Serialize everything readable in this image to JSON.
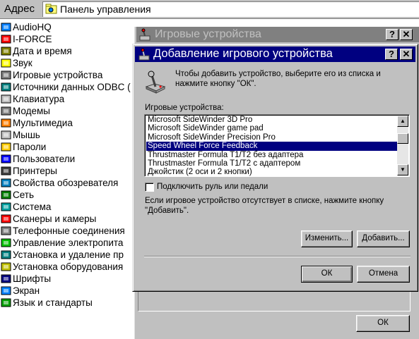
{
  "address_bar": {
    "label": "Адрес",
    "value": "Панель управления"
  },
  "control_panel": {
    "items": [
      {
        "label": "AudioHQ",
        "icon": "audio-icon"
      },
      {
        "label": "I-FORCE",
        "icon": "iforce-icon"
      },
      {
        "label": "Дата и время",
        "icon": "datetime-icon"
      },
      {
        "label": "Звук",
        "icon": "sound-icon"
      },
      {
        "label": "Игровые устройства",
        "icon": "joystick-icon"
      },
      {
        "label": "Источники данных ODBC (",
        "icon": "odbc-icon"
      },
      {
        "label": "Клавиатура",
        "icon": "keyboard-icon"
      },
      {
        "label": "Модемы",
        "icon": "modem-icon"
      },
      {
        "label": "Мультимедиа",
        "icon": "multimedia-icon"
      },
      {
        "label": "Мышь",
        "icon": "mouse-icon"
      },
      {
        "label": "Пароли",
        "icon": "passwords-icon"
      },
      {
        "label": "Пользователи",
        "icon": "users-icon"
      },
      {
        "label": "Принтеры",
        "icon": "printer-icon"
      },
      {
        "label": "Свойства обозревателя",
        "icon": "internet-icon"
      },
      {
        "label": "Сеть",
        "icon": "network-icon"
      },
      {
        "label": "Система",
        "icon": "system-icon"
      },
      {
        "label": "Сканеры и камеры",
        "icon": "scanner-icon"
      },
      {
        "label": "Телефонные соединения",
        "icon": "phone-icon"
      },
      {
        "label": "Управление электропита",
        "icon": "power-icon"
      },
      {
        "label": "Установка и удаление пр",
        "icon": "addremove-icon"
      },
      {
        "label": "Установка оборудования",
        "icon": "hardware-icon"
      },
      {
        "label": "Шрифты",
        "icon": "fonts-icon"
      },
      {
        "label": "Экран",
        "icon": "display-icon"
      },
      {
        "label": "Язык и стандарты",
        "icon": "regional-icon"
      }
    ]
  },
  "parent_window": {
    "title": "Игровые устройства",
    "help_btn": "?",
    "close_btn": "✕",
    "ok_label": "ОК"
  },
  "dialog": {
    "title": "Добавление игрового устройства",
    "help_btn": "?",
    "close_btn": "✕",
    "instruction": "Чтобы добавить устройство, выберите его из списка и нажмите кнопку \"ОК\".",
    "list_label": "Игровые устройства:",
    "devices": [
      "Microsoft SideWinder 3D Pro",
      "Microsoft SideWinder game pad",
      "Microsoft SideWinder Precision Pro",
      "Speed Wheel Force Feedback",
      "Thrustmaster Formula T1/T2 без адаптера",
      "Thrustmaster Formula T1/T2 с адаптером",
      "Джойстик (2 оси и 2 кнопки)"
    ],
    "selected_index": 3,
    "checkbox_label": "Подключить руль или педали",
    "checkbox_checked": false,
    "note": "Если игровое устройство отсутствует в списке, нажмите кнопку \"Добавить\".",
    "change_label": "Изменить...",
    "add_label": "Добавить...",
    "ok_label": "ОК",
    "cancel_label": "Отмена"
  },
  "colors": {
    "window_bg": "#c0c0c0",
    "active_title": "#000080",
    "inactive_title": "#808080",
    "selection": "#000080"
  }
}
